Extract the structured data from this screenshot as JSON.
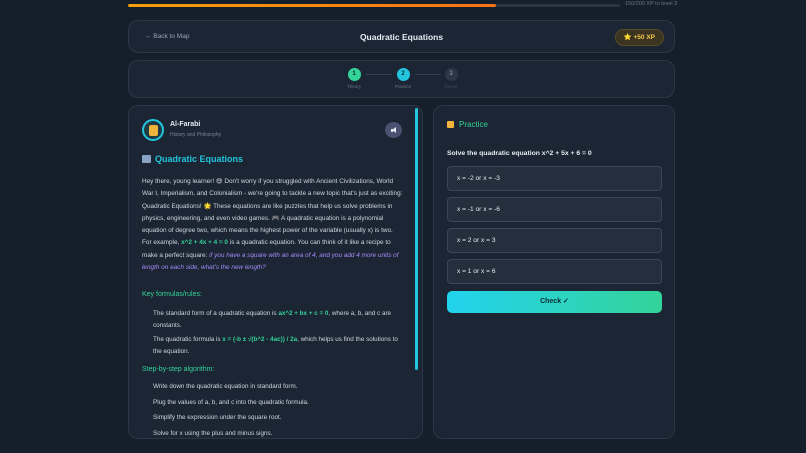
{
  "xp": {
    "progress_fraction": 0.747,
    "label": "150/200 XP to level 3"
  },
  "header": {
    "back_label": "← Back to Map",
    "title": "Quadratic Equations",
    "xp_reward": "⭐ +50 XP"
  },
  "steps": [
    {
      "number": "1",
      "label": "Theory",
      "state": "done"
    },
    {
      "number": "2",
      "label": "Practice",
      "state": "active"
    },
    {
      "number": "3",
      "label": "Result",
      "state": "pending"
    }
  ],
  "theory": {
    "author_name": "Al-Farabi",
    "author_role": "History and Philosophy",
    "section_title": "Quadratic Equations",
    "intro_1": "Hey there, young learner! 😄 Don't worry if you struggled with Ancient Civilizations, World War I, Imperialism, and Colonialism - we're going to tackle a new topic that's just as exciting: Quadratic Equations! 🌟 These equations are like puzzles that help us solve problems in physics, engineering, and even video games. 🎮 A quadratic equation is a polynomial equation of degree two, which means the highest power of the variable (usually x) is two. For example, ",
    "intro_example": "x^2 + 4x + 4 = 0",
    "intro_2": " is a quadratic equation. You can think of it like a recipe to make a perfect square: ",
    "intro_italic": "if you have a square with an area of 4, and you add 4 more units of length on each side, what's the new length?",
    "formulas_heading": "Key formulas/rules:",
    "formula_1_pre": "The standard form of a quadratic equation is ",
    "formula_1_hl": "ax^2 + bx + c = 0",
    "formula_1_post": ", where a, b, and c are constants.",
    "formula_2_pre": "The quadratic formula is ",
    "formula_2_hl": "x = (-b ± √(b^2 - 4ac)) / 2a",
    "formula_2_post": ", which helps us find the solutions to the equation.",
    "algorithm_heading": "Step-by-step algorithm:",
    "algorithm_steps": [
      "Write down the quadratic equation in standard form.",
      "Plug the values of a, b, and c into the quadratic formula.",
      "Simplify the expression under the square root.",
      "Solve for x using the plus and minus signs."
    ]
  },
  "practice": {
    "title": "Practice",
    "question": "Solve the quadratic equation x^2 + 5x + 6 = 0",
    "options": [
      "x = -2 or x = -3",
      "x = -1 or x = -6",
      "x = 2 or x = 3",
      "x = 1 or x = 6"
    ],
    "check_label": "Check ✓"
  }
}
